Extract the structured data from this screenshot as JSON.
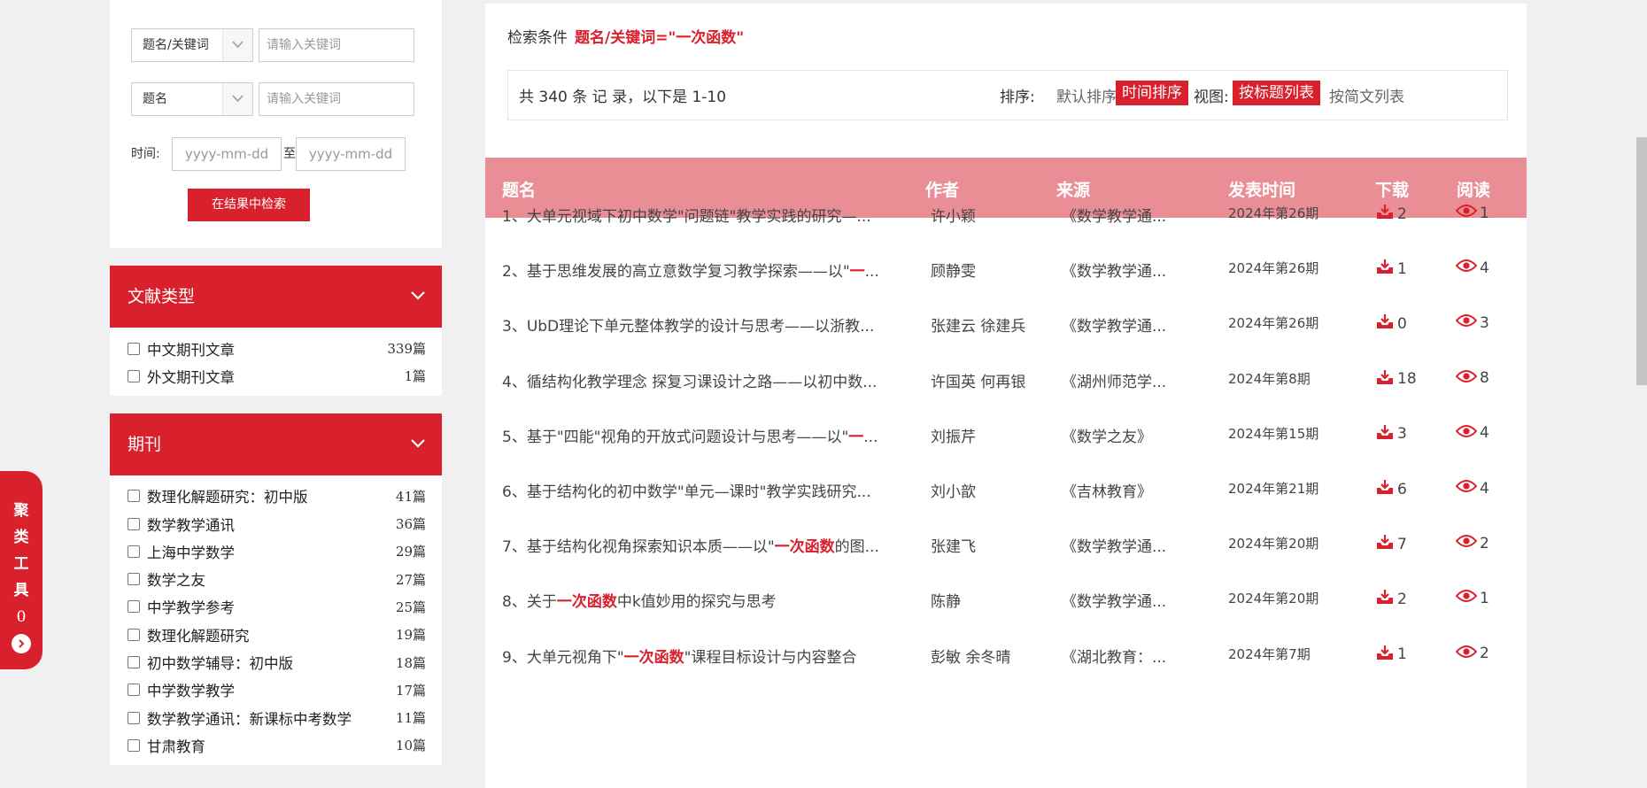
{
  "search": {
    "field1": "题名/关键词",
    "field1_placeholder": "请输入关键词",
    "field2": "题名",
    "field2_placeholder": "请输入关键词",
    "time_label": "时间:",
    "date_from": "yyyy-mm-dd",
    "to": "至",
    "date_to": "yyyy-mm-dd",
    "button": "在结果中检索"
  },
  "facets": {
    "doc_type": {
      "title": "文献类型",
      "items": [
        {
          "name": "中文期刊文章",
          "count": "339篇"
        },
        {
          "name": "外文期刊文章",
          "count": "1篇"
        }
      ]
    },
    "journal": {
      "title": "期刊",
      "items": [
        {
          "name": "数理化解题研究：初中版",
          "count": "41篇"
        },
        {
          "name": "数学教学通讯",
          "count": "36篇"
        },
        {
          "name": "上海中学数学",
          "count": "29篇"
        },
        {
          "name": "数学之友",
          "count": "27篇"
        },
        {
          "name": "中学教学参考",
          "count": "25篇"
        },
        {
          "name": "数理化解题研究",
          "count": "19篇"
        },
        {
          "name": "初中数学辅导：初中版",
          "count": "18篇"
        },
        {
          "name": "中学数学教学",
          "count": "17篇"
        },
        {
          "name": "数学教学通讯：新课标中考数学",
          "count": "11篇"
        },
        {
          "name": "甘肃教育",
          "count": "10篇"
        }
      ]
    }
  },
  "float_tool": {
    "chars": [
      "聚",
      "类",
      "工",
      "具"
    ],
    "count": "0"
  },
  "main": {
    "cond_label": "检索条件",
    "cond_value": "题名/关键词=\"一次函数\"",
    "total": "共 340 条 记 录，以下是 1-10",
    "sort_label": "排序:",
    "sort_default": "默认排序",
    "sort_time": "时间排序",
    "view_label": "视图:",
    "view_title": "按标题列表",
    "view_abstract": "按简文列表"
  },
  "table": {
    "headers": {
      "title": "题名",
      "author": "作者",
      "source": "来源",
      "date": "发表时间",
      "download": "下载",
      "read": "阅读"
    },
    "rows": [
      {
        "pre": "1、大单元视域下初中数学\"问题链\"教学实践的研究—...",
        "hl": "",
        "post": "",
        "author": "许小颖",
        "source": "《数学教学通...",
        "date": "2024年第26期",
        "dl": "2",
        "rd": "1"
      },
      {
        "pre": "2、基于思维发展的高立意数学复习教学探索——以\"",
        "hl": "一",
        "post": "...",
        "author": "顾静雯",
        "source": "《数学教学通...",
        "date": "2024年第26期",
        "dl": "1",
        "rd": "4"
      },
      {
        "pre": "3、UbD理论下单元整体教学的设计与思考——以浙教...",
        "hl": "",
        "post": "",
        "author": "张建云 徐建兵",
        "source": "《数学教学通...",
        "date": "2024年第26期",
        "dl": "0",
        "rd": "3"
      },
      {
        "pre": "4、循结构化教学理念 探复习课设计之路——以初中数...",
        "hl": "",
        "post": "",
        "author": "许国英 何再银",
        "source": "《湖州师范学...",
        "date": "2024年第8期",
        "dl": "18",
        "rd": "8"
      },
      {
        "pre": "5、基于\"四能\"视角的开放式问题设计与思考——以\"",
        "hl": "一",
        "post": "...",
        "author": "刘振芹",
        "source": "《数学之友》",
        "date": "2024年第15期",
        "dl": "3",
        "rd": "4"
      },
      {
        "pre": "6、基于结构化的初中数学\"单元—课时\"教学实践研究...",
        "hl": "",
        "post": "",
        "author": "刘小歆",
        "source": "《吉林教育》",
        "date": "2024年第21期",
        "dl": "6",
        "rd": "4"
      },
      {
        "pre": "7、基于结构化视角探索知识本质——以\"",
        "hl": "一次函数",
        "post": "的图...",
        "author": "张建飞",
        "source": "《数学教学通...",
        "date": "2024年第20期",
        "dl": "7",
        "rd": "2"
      },
      {
        "pre": "8、关于",
        "hl": "一次函数",
        "post": "中k值妙用的探究与思考",
        "author": "陈静",
        "source": "《数学教学通...",
        "date": "2024年第20期",
        "dl": "2",
        "rd": "1"
      },
      {
        "pre": "9、大单元视角下\"",
        "hl": "一次函数",
        "post": "\"课程目标设计与内容整合",
        "author": "彭敏 余冬晴",
        "source": "《湖北教育：...",
        "date": "2024年第7期",
        "dl": "1",
        "rd": "2"
      }
    ]
  },
  "colors": {
    "accent": "#d9202d",
    "header_bg": "#e98e94"
  }
}
